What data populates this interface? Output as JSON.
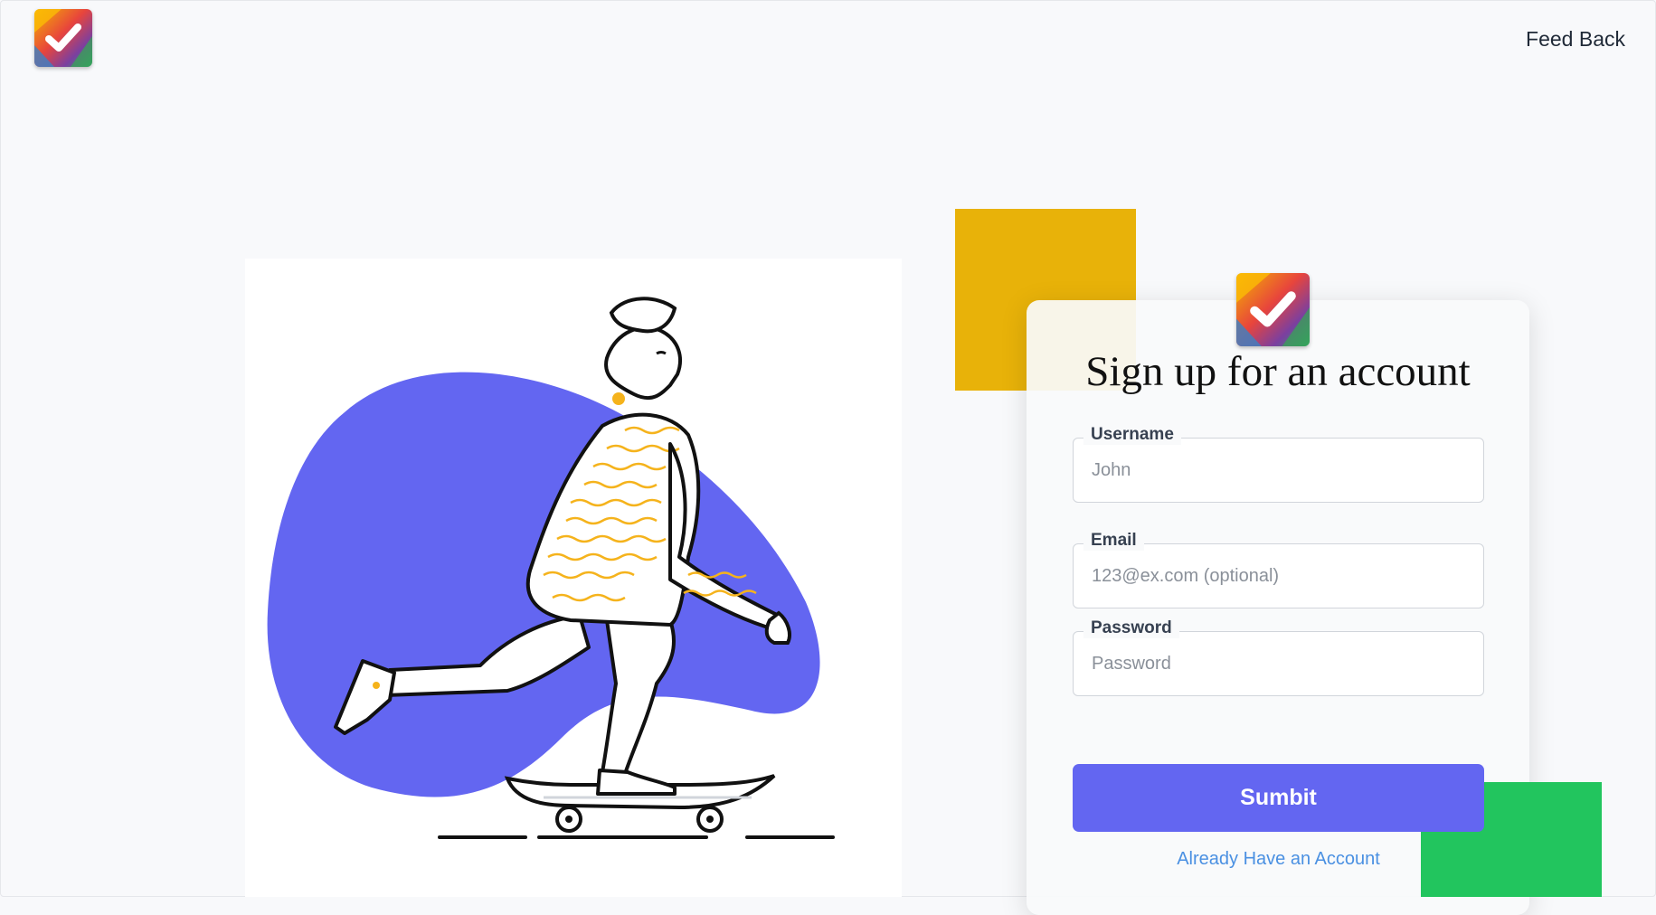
{
  "header": {
    "logo_icon": "checkmark-logo-icon",
    "feedback_label": "Feed Back"
  },
  "illustration": {
    "icon": "skateboarder-illustration",
    "blob_color": "#6366f1",
    "accent_color": "#f5b31c"
  },
  "decor": {
    "yellow": "#e8b209",
    "green": "#22c55e"
  },
  "signup": {
    "title": "Sign up for an account",
    "fields": [
      {
        "label": "Username",
        "placeholder": "John",
        "value": ""
      },
      {
        "label": "Email",
        "placeholder": "123@ex.com (optional)",
        "value": ""
      },
      {
        "label": "Password",
        "placeholder": "Password",
        "value": ""
      }
    ],
    "submit_label": "Sumbit",
    "login_link": "Already Have an Account"
  }
}
